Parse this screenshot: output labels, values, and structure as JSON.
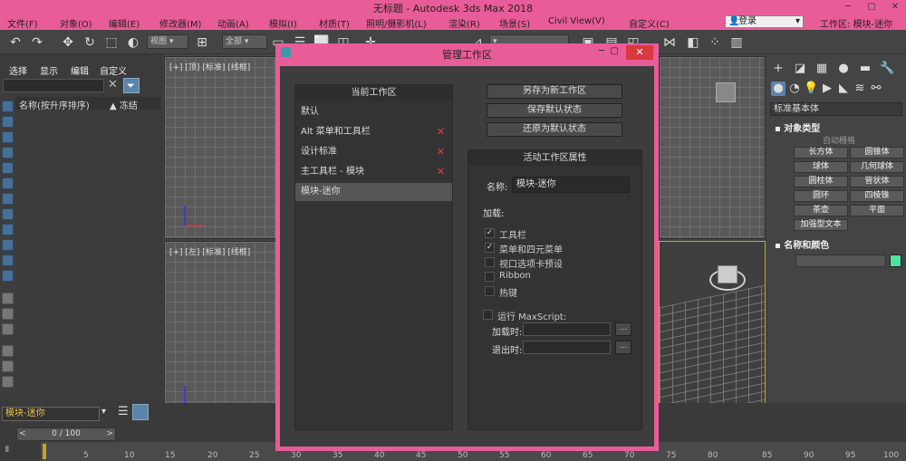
{
  "app": {
    "title": "无标题 - Autodesk 3ds Max 2018",
    "window_buttons": [
      "─",
      "▢",
      "✕"
    ]
  },
  "menu": {
    "items": [
      "文件(F)",
      "对象(O)",
      "编辑(E)",
      "修改器(M)",
      "动画(A)",
      "模拟(I)",
      "材质(T)",
      "照明/摄影机(L)",
      "渲染(R)",
      "场景(S)",
      "Civil View(V)",
      "自定义(C)"
    ],
    "login": "登录",
    "workspace_label": "工作区:",
    "workspace_value": "模块-迷你"
  },
  "toolbar": {
    "view_dropdown": "视图",
    "selection_dropdown": "全部"
  },
  "explorer": {
    "tabs": [
      "选择",
      "显示",
      "编辑",
      "自定义"
    ],
    "col_name": "名称(按升序排序)",
    "col_freeze": "▲ 冻结"
  },
  "viewports": {
    "top_left": "[+] [顶] [标准] [线框]",
    "bottom_left": "[+] [左] [标准] [线框]"
  },
  "right_panel": {
    "category": "标准基本体",
    "object_type_header": "对象类型",
    "auto_grid": "自动栅格",
    "objects": [
      "长方体",
      "圆锥体",
      "球体",
      "几何球体",
      "圆柱体",
      "管状体",
      "圆环",
      "四棱锥",
      "茶壶",
      "平面",
      "加强型文本"
    ],
    "name_color_header": "名称和颜色",
    "swatch_color": "#4fe3a2"
  },
  "bottom": {
    "workspace_select": "模块-迷你",
    "frame_slider": "0 / 100",
    "ticks": [
      "5",
      "10",
      "15",
      "20",
      "25",
      "30",
      "35",
      "40",
      "45",
      "50",
      "55",
      "60",
      "65",
      "70",
      "75",
      "80",
      "85",
      "90",
      "95",
      "100"
    ]
  },
  "dialog": {
    "title": "管理工作区",
    "current_header": "当前工作区",
    "workspaces": [
      {
        "name": "默认",
        "deletable": false
      },
      {
        "name": "Alt 菜单和工具栏",
        "deletable": true
      },
      {
        "name": "设计标准",
        "deletable": true
      },
      {
        "name": "主工具栏 - 模块",
        "deletable": true
      },
      {
        "name": "模块-迷你",
        "deletable": false,
        "selected": true
      }
    ],
    "save_as_new": "另存为新工作区",
    "save_default": "保存默认状态",
    "restore_default": "还原为默认状态",
    "props_header": "活动工作区属性",
    "name_label": "名称:",
    "name_value": "模块-迷你",
    "load_label": "加载:",
    "options": [
      {
        "label": "工具栏",
        "checked": true
      },
      {
        "label": "菜单和四元菜单",
        "checked": true
      },
      {
        "label": "视口选项卡预设",
        "checked": false
      },
      {
        "label": "Ribbon",
        "checked": false
      },
      {
        "label": "热键",
        "checked": false
      }
    ],
    "run_maxscript": "运行 MaxScript:",
    "on_load": "加载时:",
    "on_exit": "退出时:",
    "browse": "..."
  }
}
